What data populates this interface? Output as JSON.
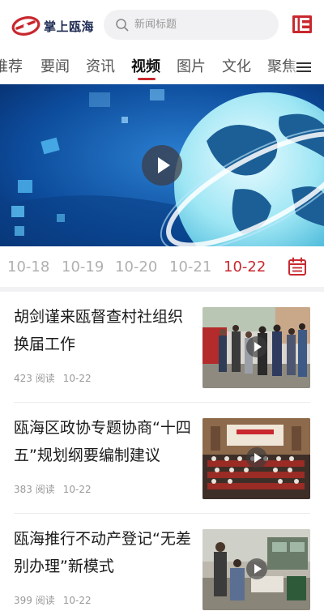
{
  "header": {
    "app_name": "掌上瓯海",
    "search_placeholder": "新闻标题",
    "brand_color": "#c8282e",
    "paper_icon": "newspaper-icon"
  },
  "tabs": {
    "items": [
      {
        "label": "推荐",
        "active": false
      },
      {
        "label": "要闻",
        "active": false
      },
      {
        "label": "资讯",
        "active": false
      },
      {
        "label": "视频",
        "active": true
      },
      {
        "label": "图片",
        "active": false
      },
      {
        "label": "文化",
        "active": false
      },
      {
        "label": "聚焦",
        "active": false
      }
    ],
    "menu_icon": "hamburger-menu-icon"
  },
  "video": {
    "play_icon": "play-icon"
  },
  "dates": {
    "items": [
      {
        "label": "10-18",
        "active": false
      },
      {
        "label": "10-19",
        "active": false
      },
      {
        "label": "10-20",
        "active": false
      },
      {
        "label": "10-21",
        "active": false
      },
      {
        "label": "10-22",
        "active": true
      }
    ],
    "calendar_icon": "calendar-icon"
  },
  "news": [
    {
      "title": "胡剑谨来瓯督查村社组织换届工作",
      "reads": "423 阅读",
      "date": "10-22"
    },
    {
      "title": "瓯海区政协专题协商“十四五”规划纲要编制建议",
      "reads": "383 阅读",
      "date": "10-22"
    },
    {
      "title": "瓯海推行不动产登记“无差别办理”新模式",
      "reads": "399 阅读",
      "date": "10-22"
    }
  ]
}
